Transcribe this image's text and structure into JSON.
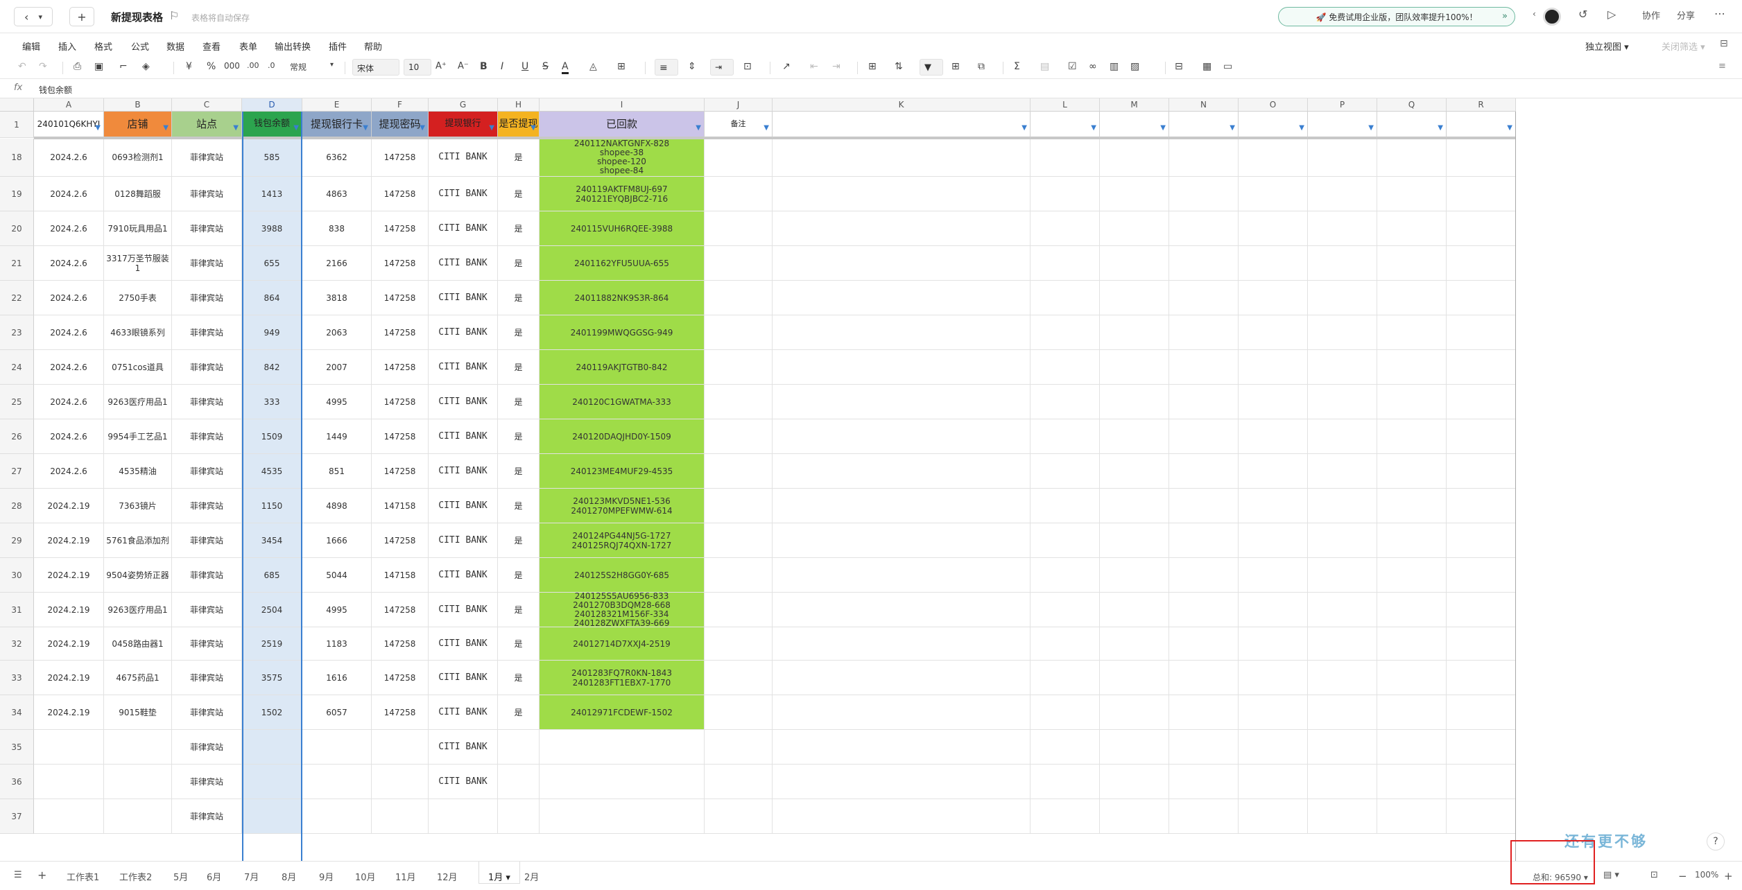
{
  "titlebar": {
    "back": "‹",
    "dropdown": "▾",
    "new_tab": "+",
    "doc_title": "新提现表格",
    "save_status": "表格将自动保存",
    "promo": "🚀 免费试用企业版，团队效率提升100%！",
    "collab": "协作",
    "share": "分享"
  },
  "menu": {
    "items": [
      "编辑",
      "插入",
      "格式",
      "公式",
      "数据",
      "查看",
      "表单",
      "输出转换",
      "插件",
      "帮助"
    ],
    "view_mode": "独立视图 ▾",
    "filter": "关闭筛选 ▾"
  },
  "toolbar": {
    "style": "常规",
    "font": "宋体",
    "size": "10"
  },
  "formula": {
    "fx": "fx",
    "value": "钱包余额"
  },
  "grid": {
    "columns": [
      "A",
      "B",
      "C",
      "D",
      "E",
      "F",
      "G",
      "H",
      "I",
      "J",
      "K",
      "L",
      "M",
      "N",
      "O",
      "P",
      "Q",
      "R"
    ],
    "header_row_num": "1",
    "headers": [
      "240101Q6KHYJ",
      "店铺",
      "站点",
      "钱包余额",
      "提现银行卡",
      "提现密码",
      "提现银行",
      "是否提现",
      "已回款",
      "备注",
      "",
      "",
      "",
      "",
      "",
      "",
      "",
      ""
    ],
    "header_colors": [
      "#ffffff",
      "#f08a3c",
      "#a8d08d",
      "#2ca44e",
      "#8ea6c8",
      "#8ea6c8",
      "#d42020",
      "#f4b321",
      "#cbc4e8",
      "#ffffff",
      "#ffffff",
      "#ffffff",
      "#ffffff",
      "#ffffff",
      "#ffffff",
      "#ffffff",
      "#ffffff",
      "#ffffff"
    ],
    "rows": [
      {
        "n": "18",
        "cells": [
          "2024.2.6",
          "0693检测剂1",
          "菲律宾站",
          "585",
          "6362",
          "147258",
          "CITI BANK",
          "是",
          "240112NAKTGNFX-828\nshopee-38\nshopee-120\nshopee-84"
        ]
      },
      {
        "n": "19",
        "cells": [
          "2024.2.6",
          "0128舞蹈服",
          "菲律宾站",
          "1413",
          "4863",
          "147258",
          "CITI BANK",
          "是",
          "240119AKTFM8UJ-697\n240121EYQBJBC2-716"
        ]
      },
      {
        "n": "20",
        "cells": [
          "2024.2.6",
          "7910玩具用品1",
          "菲律宾站",
          "3988",
          "838",
          "147258",
          "CITI BANK",
          "是",
          "240115VUH6RQEE-3988"
        ]
      },
      {
        "n": "21",
        "cells": [
          "2024.2.6",
          "3317万圣节服装1",
          "菲律宾站",
          "655",
          "2166",
          "147258",
          "CITI BANK",
          "是",
          "2401162YFU5UUA-655"
        ]
      },
      {
        "n": "22",
        "cells": [
          "2024.2.6",
          "2750手表",
          "菲律宾站",
          "864",
          "3818",
          "147258",
          "CITI BANK",
          "是",
          "24011882NK9S3R-864"
        ]
      },
      {
        "n": "23",
        "cells": [
          "2024.2.6",
          "4633眼镜系列",
          "菲律宾站",
          "949",
          "2063",
          "147258",
          "CITI BANK",
          "是",
          "2401199MWQGGSG-949"
        ]
      },
      {
        "n": "24",
        "cells": [
          "2024.2.6",
          "0751cos道具",
          "菲律宾站",
          "842",
          "2007",
          "147258",
          "CITI BANK",
          "是",
          "240119AKJTGTB0-842"
        ]
      },
      {
        "n": "25",
        "cells": [
          "2024.2.6",
          "9263医疗用品1",
          "菲律宾站",
          "333",
          "4995",
          "147258",
          "CITI BANK",
          "是",
          "240120C1GWATMA-333"
        ]
      },
      {
        "n": "26",
        "cells": [
          "2024.2.6",
          "9954手工艺品1",
          "菲律宾站",
          "1509",
          "1449",
          "147258",
          "CITI BANK",
          "是",
          "240120DAQJHD0Y-1509"
        ]
      },
      {
        "n": "27",
        "cells": [
          "2024.2.6",
          "4535精油",
          "菲律宾站",
          "4535",
          "851",
          "147258",
          "CITI BANK",
          "是",
          "240123ME4MUF29-4535"
        ]
      },
      {
        "n": "28",
        "cells": [
          "2024.2.19",
          "7363镜片",
          "菲律宾站",
          "1150",
          "4898",
          "147158",
          "CITI BANK",
          "是",
          "240123MKVD5NE1-536\n2401270MPEFWMW-614"
        ]
      },
      {
        "n": "29",
        "cells": [
          "2024.2.19",
          "5761食品添加剂",
          "菲律宾站",
          "3454",
          "1666",
          "147258",
          "CITI BANK",
          "是",
          "240124PG44NJ5G-1727\n240125RQJ74QXN-1727"
        ]
      },
      {
        "n": "30",
        "cells": [
          "2024.2.19",
          "9504姿势矫正器",
          "菲律宾站",
          "685",
          "5044",
          "147158",
          "CITI BANK",
          "是",
          "240125S2H8GG0Y-685"
        ]
      },
      {
        "n": "31",
        "cells": [
          "2024.2.19",
          "9263医疗用品1",
          "菲律宾站",
          "2504",
          "4995",
          "147258",
          "CITI BANK",
          "是",
          "240125S5AU6956-833\n2401270B3DQM28-668\n240128321M156F-334\n240128ZWXFTA39-669"
        ]
      },
      {
        "n": "32",
        "cells": [
          "2024.2.19",
          "0458路由器1",
          "菲律宾站",
          "2519",
          "1183",
          "147258",
          "CITI BANK",
          "是",
          "24012714D7XXJ4-2519"
        ]
      },
      {
        "n": "33",
        "cells": [
          "2024.2.19",
          "4675药品1",
          "菲律宾站",
          "3575",
          "1616",
          "147258",
          "CITI BANK",
          "是",
          "2401283FQ7R0KN-1843\n2401283FT1EBX7-1770"
        ]
      },
      {
        "n": "34",
        "cells": [
          "2024.2.19",
          "9015鞋垫",
          "菲律宾站",
          "1502",
          "6057",
          "147258",
          "CITI BANK",
          "是",
          "24012971FCDEWF-1502"
        ]
      },
      {
        "n": "35",
        "cells": [
          "",
          "",
          "菲律宾站",
          "",
          "",
          "",
          "CITI BANK",
          "",
          ""
        ]
      },
      {
        "n": "36",
        "cells": [
          "",
          "",
          "菲律宾站",
          "",
          "",
          "",
          "CITI BANK",
          "",
          ""
        ]
      },
      {
        "n": "37",
        "cells": [
          "",
          "",
          "菲律宾站",
          "",
          "",
          "",
          "",
          "",
          ""
        ]
      }
    ]
  },
  "watermark": "还有更不够",
  "help": "?",
  "bottom": {
    "menu": "☰",
    "add": "+",
    "tabs": [
      "工作表1",
      "工作表2",
      "5月",
      "6月",
      "7月",
      "8月",
      "9月",
      "10月",
      "11月",
      "12月",
      "1月 ▾",
      "2月"
    ],
    "sum": "总和: 96590 ▾",
    "zoom": "100%"
  }
}
